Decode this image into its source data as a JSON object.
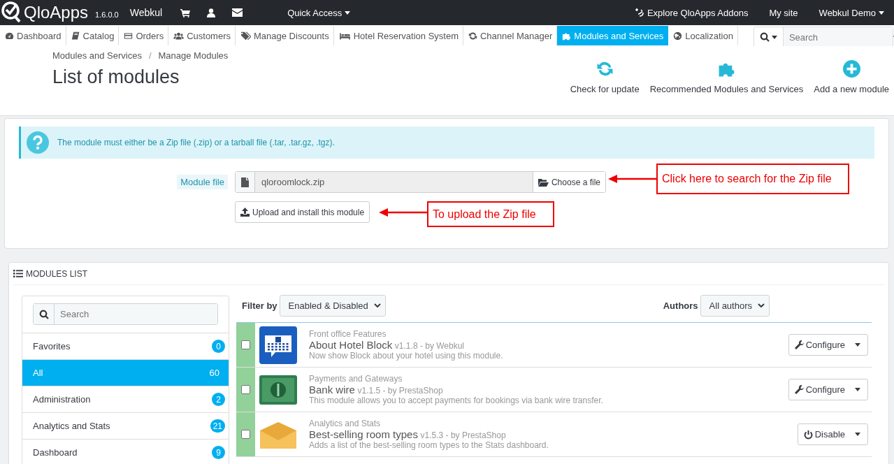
{
  "top_bar": {
    "logo": "QloApps",
    "version": "1.6.0.0",
    "shop": "Webkul",
    "quick_access": "Quick Access",
    "links": [
      "Explore QloApps Addons",
      "My site"
    ],
    "user": "Webkul Demo"
  },
  "nav": {
    "tabs": [
      {
        "label": "Dashboard",
        "selected": false
      },
      {
        "label": "Catalog",
        "selected": false
      },
      {
        "label": "Orders",
        "selected": false
      },
      {
        "label": "Customers",
        "selected": false
      },
      {
        "label": "Manage Discounts",
        "selected": false
      },
      {
        "label": "Hotel Reservation System",
        "selected": false
      },
      {
        "label": "Channel Manager",
        "selected": false
      },
      {
        "label": "Modules and Services",
        "selected": true
      },
      {
        "label": "Localization",
        "selected": false
      }
    ],
    "search": {
      "placeholder": "Search"
    }
  },
  "header": {
    "breadcrumb": [
      "Modules and Services",
      "Manage Modules"
    ],
    "breadcrumb_separator": "/",
    "title": "List of modules",
    "actions": [
      {
        "label": "Check for update"
      },
      {
        "label": "Recommended Modules and Services"
      },
      {
        "label": "Add a new module"
      }
    ]
  },
  "upload": {
    "info": "The module must either be a Zip file (.zip) or a tarball file (.tar, .tar.gz, .tgz).",
    "field_label": "Module file",
    "file_value": "qloroomlock.zip",
    "choose_button": "Choose a file",
    "upload_button": "Upload and install this module"
  },
  "annotations": [
    {
      "text": "Click here to search for the Zip file"
    },
    {
      "text": "To upload the Zip file"
    }
  ],
  "modules_list": {
    "title": "MODULES LIST",
    "search": {
      "placeholder": "Search"
    },
    "categories": [
      {
        "label": "Favorites",
        "count": "0",
        "selected": false
      },
      {
        "label": "All",
        "count": "60",
        "selected": true
      },
      {
        "label": "Administration",
        "count": "2",
        "selected": false
      },
      {
        "label": "Analytics and Stats",
        "count": "21",
        "selected": false
      },
      {
        "label": "Dashboard",
        "count": "9",
        "selected": false
      }
    ],
    "filter_label": "Filter by",
    "filter_value": "Enabled & Disabled",
    "authors_label": "Authors",
    "authors_value": "All authors",
    "modules": [
      {
        "category": "Front office Features",
        "name": "About Hotel Block",
        "details": "v1.1.8 - by Webkul",
        "description": "Now show Block about your hotel using this module.",
        "action": "Configure",
        "enabled": true,
        "checked": false
      },
      {
        "category": "Payments and Gateways",
        "name": "Bank wire",
        "details": "v1.1.5 - by PrestaShop",
        "description": "This module allows you to accept payments for bookings via bank wire transfer.",
        "action": "Configure",
        "enabled": true,
        "checked": false
      },
      {
        "category": "Analytics and Stats",
        "name": "Best-selling room types",
        "details": "v1.5.3 - by PrestaShop",
        "description": "Adds a list of the best-selling room types to the Stats dashboard.",
        "action": "Disable",
        "enabled": true,
        "checked": false
      }
    ]
  }
}
